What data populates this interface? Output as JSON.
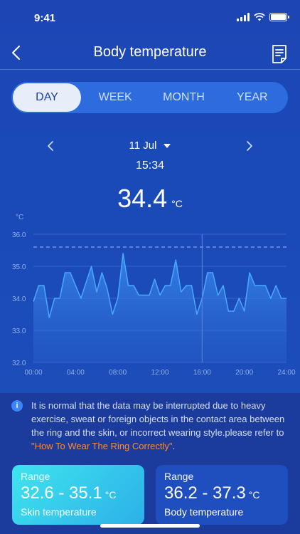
{
  "status_bar": {
    "time": "9:41"
  },
  "nav": {
    "title": "Body temperature"
  },
  "tabs": [
    {
      "label": "DAY",
      "active": true
    },
    {
      "label": "WEEK",
      "active": false
    },
    {
      "label": "MONTH",
      "active": false
    },
    {
      "label": "YEAR",
      "active": false
    }
  ],
  "date_selector": {
    "date": "11 Jul",
    "time": "15:34"
  },
  "reading": {
    "value": "34.4",
    "unit": "°C"
  },
  "chart_data": {
    "type": "area",
    "ylabel": "°C",
    "ylim": [
      32.0,
      36.0
    ],
    "yticks": [
      "36.0",
      "35.0",
      "34.0",
      "33.0",
      "32.0"
    ],
    "reference_line": 35.6,
    "cursor_x": "16:00",
    "xticks": [
      "00:00",
      "04:00",
      "08:00",
      "12:00",
      "16:00",
      "20:00",
      "24:00"
    ],
    "x": [
      "00:00",
      "00:30",
      "01:00",
      "01:30",
      "02:00",
      "02:30",
      "03:00",
      "03:30",
      "04:00",
      "04:30",
      "05:00",
      "05:30",
      "06:00",
      "06:30",
      "07:00",
      "07:30",
      "08:00",
      "08:30",
      "09:00",
      "09:30",
      "10:00",
      "10:30",
      "11:00",
      "11:30",
      "12:00",
      "12:30",
      "13:00",
      "13:30",
      "14:00",
      "14:30",
      "15:00",
      "15:30",
      "16:00",
      "16:30",
      "17:00",
      "17:30",
      "18:00",
      "18:30",
      "19:00",
      "19:30",
      "20:00",
      "20:30",
      "21:00",
      "21:30",
      "22:00",
      "22:30",
      "23:00",
      "23:30",
      "24:00"
    ],
    "values": [
      33.9,
      34.4,
      34.4,
      33.4,
      34.0,
      34.0,
      34.8,
      34.8,
      34.4,
      34.0,
      34.5,
      35.0,
      34.2,
      34.8,
      34.3,
      33.5,
      34.0,
      35.4,
      34.4,
      34.4,
      34.1,
      34.1,
      34.1,
      34.6,
      34.1,
      34.4,
      34.4,
      35.2,
      34.2,
      34.4,
      34.4,
      33.5,
      34.0,
      34.8,
      34.8,
      34.1,
      34.4,
      33.6,
      33.6,
      34.0,
      33.6,
      34.8,
      34.4,
      34.4,
      34.4,
      34.0,
      34.4,
      34.0,
      34.0
    ]
  },
  "notice": {
    "text": "It is normal that the data may be interrupted due to heavy exercise, sweat or foreign objects in the contact area between the ring and the skin, or incorrect wearing style.please refer to ",
    "link": "\"How To Wear The Ring Correctly\"",
    "end": "."
  },
  "cards": {
    "skin": {
      "label": "Range",
      "range": "32.6 - 35.1",
      "unit": "°C",
      "name": "Skin temperature"
    },
    "body": {
      "label": "Range",
      "range": "36.2 - 37.3",
      "unit": "°C",
      "name": "Body temperature"
    }
  },
  "colors": {
    "background": "#1b3c9c",
    "accent": "#2d6cdf",
    "chart_line": "#4aa8ff",
    "link": "#ff8a2b"
  }
}
